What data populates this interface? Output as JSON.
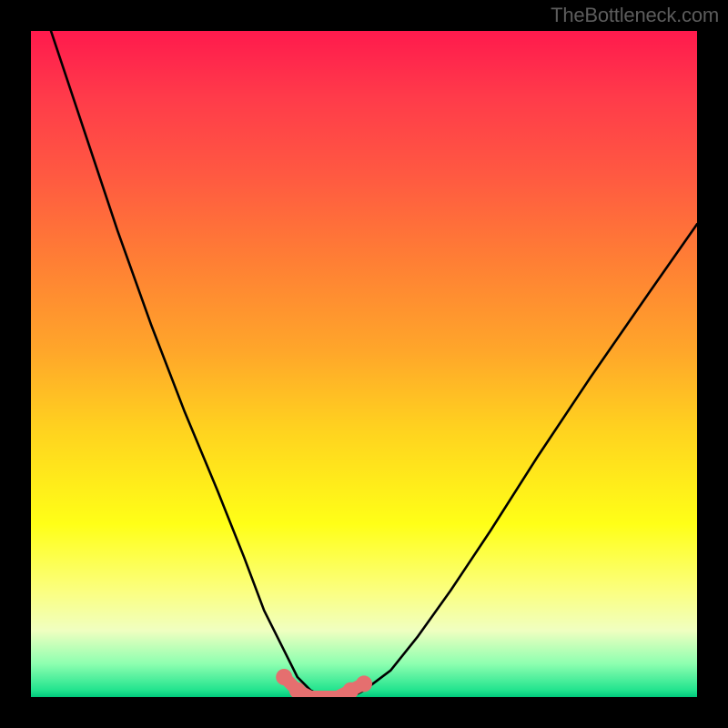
{
  "attribution": "TheBottleneck.com",
  "chart_data": {
    "type": "line",
    "title": "",
    "xlabel": "",
    "ylabel": "",
    "xlim": [
      0,
      100
    ],
    "ylim": [
      0,
      100
    ],
    "series": [
      {
        "name": "bottleneck-curve",
        "x": [
          3,
          8,
          13,
          18,
          23,
          28,
          32,
          35,
          38,
          40,
          42,
          44,
          46,
          48,
          50,
          54,
          58,
          63,
          69,
          76,
          84,
          93,
          100
        ],
        "values": [
          100,
          85,
          70,
          56,
          43,
          31,
          21,
          13,
          7,
          3,
          1,
          0,
          0,
          0,
          1,
          4,
          9,
          16,
          25,
          36,
          48,
          61,
          71
        ]
      },
      {
        "name": "highlight-zone",
        "x": [
          38,
          40,
          42,
          44,
          46,
          48,
          50
        ],
        "values": [
          3,
          1,
          0,
          0,
          0,
          1,
          2
        ]
      }
    ]
  }
}
